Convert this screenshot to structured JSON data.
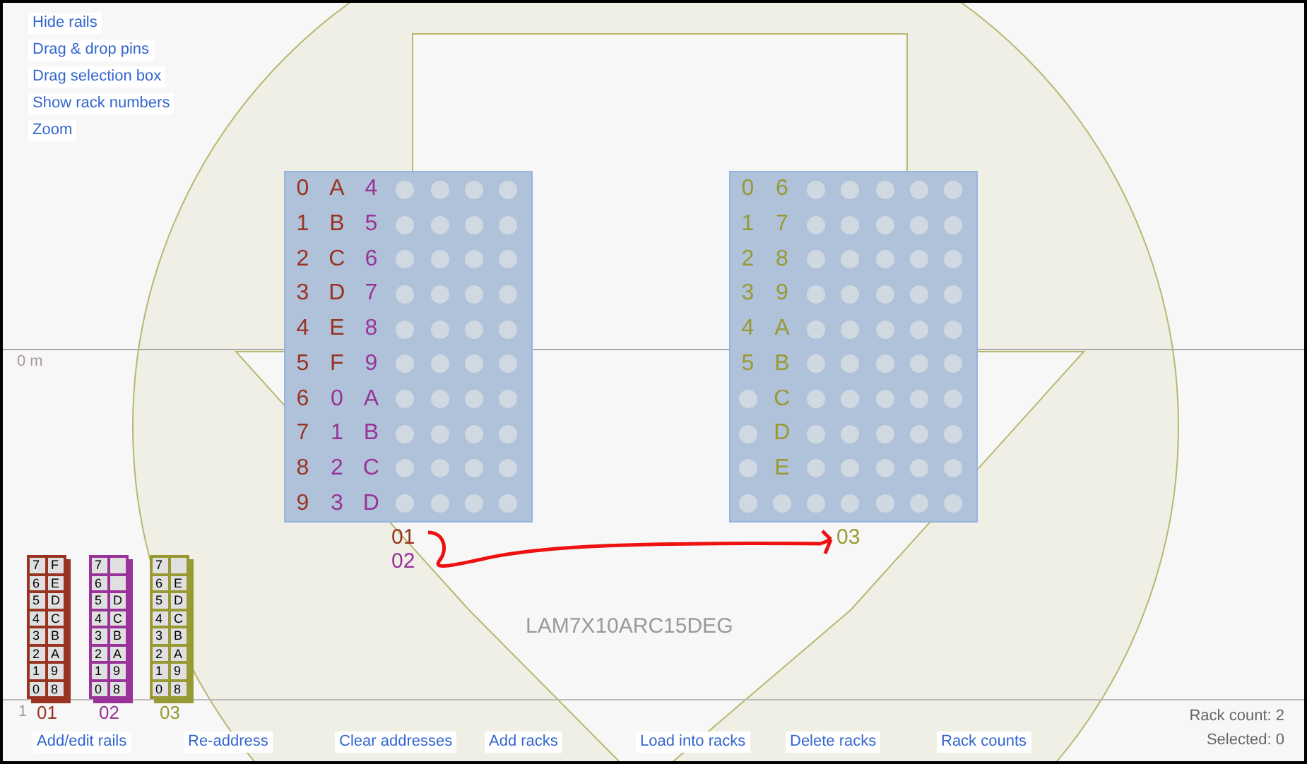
{
  "tool_links": [
    "Hide rails",
    "Drag & drop pins",
    "Drag selection box",
    "Show rack numbers",
    "Zoom"
  ],
  "ruler_labels": [
    "0 m",
    "1"
  ],
  "panels": [
    {
      "rack_labels": [
        {
          "text": "01",
          "color": "#993322"
        },
        {
          "text": "02",
          "color": "#993399"
        }
      ],
      "rows": [
        [
          {
            "kind": "label",
            "text": "0",
            "color": "#993322"
          },
          {
            "kind": "label",
            "text": "A",
            "color": "#993322"
          },
          {
            "kind": "label",
            "text": "4",
            "color": "#993399"
          },
          {
            "kind": "dot"
          },
          {
            "kind": "dot"
          },
          {
            "kind": "dot"
          },
          {
            "kind": "dot"
          }
        ],
        [
          {
            "kind": "label",
            "text": "1",
            "color": "#993322"
          },
          {
            "kind": "label",
            "text": "B",
            "color": "#993322"
          },
          {
            "kind": "label",
            "text": "5",
            "color": "#993399"
          },
          {
            "kind": "dot"
          },
          {
            "kind": "dot"
          },
          {
            "kind": "dot"
          },
          {
            "kind": "dot"
          }
        ],
        [
          {
            "kind": "label",
            "text": "2",
            "color": "#993322"
          },
          {
            "kind": "label",
            "text": "C",
            "color": "#993322"
          },
          {
            "kind": "label",
            "text": "6",
            "color": "#993399"
          },
          {
            "kind": "dot"
          },
          {
            "kind": "dot"
          },
          {
            "kind": "dot"
          },
          {
            "kind": "dot"
          }
        ],
        [
          {
            "kind": "label",
            "text": "3",
            "color": "#993322"
          },
          {
            "kind": "label",
            "text": "D",
            "color": "#993322"
          },
          {
            "kind": "label",
            "text": "7",
            "color": "#993399"
          },
          {
            "kind": "dot"
          },
          {
            "kind": "dot"
          },
          {
            "kind": "dot"
          },
          {
            "kind": "dot"
          }
        ],
        [
          {
            "kind": "label",
            "text": "4",
            "color": "#993322"
          },
          {
            "kind": "label",
            "text": "E",
            "color": "#993322"
          },
          {
            "kind": "label",
            "text": "8",
            "color": "#993399"
          },
          {
            "kind": "dot"
          },
          {
            "kind": "dot"
          },
          {
            "kind": "dot"
          },
          {
            "kind": "dot"
          }
        ],
        [
          {
            "kind": "label",
            "text": "5",
            "color": "#993322"
          },
          {
            "kind": "label",
            "text": "F",
            "color": "#993322"
          },
          {
            "kind": "label",
            "text": "9",
            "color": "#993399"
          },
          {
            "kind": "dot"
          },
          {
            "kind": "dot"
          },
          {
            "kind": "dot"
          },
          {
            "kind": "dot"
          }
        ],
        [
          {
            "kind": "label",
            "text": "6",
            "color": "#993322"
          },
          {
            "kind": "label",
            "text": "0",
            "color": "#993399"
          },
          {
            "kind": "label",
            "text": "A",
            "color": "#993399"
          },
          {
            "kind": "dot"
          },
          {
            "kind": "dot"
          },
          {
            "kind": "dot"
          },
          {
            "kind": "dot"
          }
        ],
        [
          {
            "kind": "label",
            "text": "7",
            "color": "#993322"
          },
          {
            "kind": "label",
            "text": "1",
            "color": "#993399"
          },
          {
            "kind": "label",
            "text": "B",
            "color": "#993399"
          },
          {
            "kind": "dot"
          },
          {
            "kind": "dot"
          },
          {
            "kind": "dot"
          },
          {
            "kind": "dot"
          }
        ],
        [
          {
            "kind": "label",
            "text": "8",
            "color": "#993322"
          },
          {
            "kind": "label",
            "text": "2",
            "color": "#993399"
          },
          {
            "kind": "label",
            "text": "C",
            "color": "#993399"
          },
          {
            "kind": "dot"
          },
          {
            "kind": "dot"
          },
          {
            "kind": "dot"
          },
          {
            "kind": "dot"
          }
        ],
        [
          {
            "kind": "label",
            "text": "9",
            "color": "#993322"
          },
          {
            "kind": "label",
            "text": "3",
            "color": "#993399"
          },
          {
            "kind": "label",
            "text": "D",
            "color": "#993399"
          },
          {
            "kind": "dot"
          },
          {
            "kind": "dot"
          },
          {
            "kind": "dot"
          },
          {
            "kind": "dot"
          }
        ]
      ]
    },
    {
      "rack_labels": [
        {
          "text": "03",
          "color": "#999933"
        }
      ],
      "rows": [
        [
          {
            "kind": "label",
            "text": "0",
            "color": "#999933"
          },
          {
            "kind": "label",
            "text": "6",
            "color": "#999933"
          },
          {
            "kind": "dot"
          },
          {
            "kind": "dot"
          },
          {
            "kind": "dot"
          },
          {
            "kind": "dot"
          },
          {
            "kind": "dot"
          }
        ],
        [
          {
            "kind": "label",
            "text": "1",
            "color": "#999933"
          },
          {
            "kind": "label",
            "text": "7",
            "color": "#999933"
          },
          {
            "kind": "dot"
          },
          {
            "kind": "dot"
          },
          {
            "kind": "dot"
          },
          {
            "kind": "dot"
          },
          {
            "kind": "dot"
          }
        ],
        [
          {
            "kind": "label",
            "text": "2",
            "color": "#999933"
          },
          {
            "kind": "label",
            "text": "8",
            "color": "#999933"
          },
          {
            "kind": "dot"
          },
          {
            "kind": "dot"
          },
          {
            "kind": "dot"
          },
          {
            "kind": "dot"
          },
          {
            "kind": "dot"
          }
        ],
        [
          {
            "kind": "label",
            "text": "3",
            "color": "#999933"
          },
          {
            "kind": "label",
            "text": "9",
            "color": "#999933"
          },
          {
            "kind": "dot"
          },
          {
            "kind": "dot"
          },
          {
            "kind": "dot"
          },
          {
            "kind": "dot"
          },
          {
            "kind": "dot"
          }
        ],
        [
          {
            "kind": "label",
            "text": "4",
            "color": "#999933"
          },
          {
            "kind": "label",
            "text": "A",
            "color": "#999933"
          },
          {
            "kind": "dot"
          },
          {
            "kind": "dot"
          },
          {
            "kind": "dot"
          },
          {
            "kind": "dot"
          },
          {
            "kind": "dot"
          }
        ],
        [
          {
            "kind": "label",
            "text": "5",
            "color": "#999933"
          },
          {
            "kind": "label",
            "text": "B",
            "color": "#999933"
          },
          {
            "kind": "dot"
          },
          {
            "kind": "dot"
          },
          {
            "kind": "dot"
          },
          {
            "kind": "dot"
          },
          {
            "kind": "dot"
          }
        ],
        [
          {
            "kind": "dot"
          },
          {
            "kind": "label",
            "text": "C",
            "color": "#999933"
          },
          {
            "kind": "dot"
          },
          {
            "kind": "dot"
          },
          {
            "kind": "dot"
          },
          {
            "kind": "dot"
          },
          {
            "kind": "dot"
          }
        ],
        [
          {
            "kind": "dot"
          },
          {
            "kind": "label",
            "text": "D",
            "color": "#999933"
          },
          {
            "kind": "dot"
          },
          {
            "kind": "dot"
          },
          {
            "kind": "dot"
          },
          {
            "kind": "dot"
          },
          {
            "kind": "dot"
          }
        ],
        [
          {
            "kind": "dot"
          },
          {
            "kind": "label",
            "text": "E",
            "color": "#999933"
          },
          {
            "kind": "dot"
          },
          {
            "kind": "dot"
          },
          {
            "kind": "dot"
          },
          {
            "kind": "dot"
          },
          {
            "kind": "dot"
          }
        ],
        [
          {
            "kind": "dot"
          },
          {
            "kind": "dot"
          },
          {
            "kind": "dot"
          },
          {
            "kind": "dot"
          },
          {
            "kind": "dot"
          },
          {
            "kind": "dot"
          },
          {
            "kind": "dot"
          }
        ]
      ]
    }
  ],
  "layout_name": "LAM7X10ARC15DEG",
  "racks": [
    {
      "name": "01",
      "color": "#993322",
      "rows": [
        [
          "7",
          "F"
        ],
        [
          "6",
          "E"
        ],
        [
          "5",
          "D"
        ],
        [
          "4",
          "C"
        ],
        [
          "3",
          "B"
        ],
        [
          "2",
          "A"
        ],
        [
          "1",
          "9"
        ],
        [
          "0",
          "8"
        ]
      ]
    },
    {
      "name": "02",
      "color": "#993399",
      "rows": [
        [
          "7"
        ],
        [
          "6"
        ],
        [
          "5",
          "D"
        ],
        [
          "4",
          "C"
        ],
        [
          "3",
          "B"
        ],
        [
          "2",
          "A"
        ],
        [
          "1",
          "9"
        ],
        [
          "0",
          "8"
        ]
      ]
    },
    {
      "name": "03",
      "color": "#999933",
      "rows": [
        [
          "7"
        ],
        [
          "6",
          "E"
        ],
        [
          "5",
          "D"
        ],
        [
          "4",
          "C"
        ],
        [
          "3",
          "B"
        ],
        [
          "2",
          "A"
        ],
        [
          "1",
          "9"
        ],
        [
          "0",
          "8"
        ]
      ]
    }
  ],
  "toolbar": [
    "Add/edit rails",
    "Re-address",
    "Clear addresses",
    "Add racks",
    "Load into racks",
    "Delete racks",
    "Rack counts"
  ],
  "status": {
    "rack_count": "Rack count: 2",
    "selected": "Selected: 0"
  }
}
